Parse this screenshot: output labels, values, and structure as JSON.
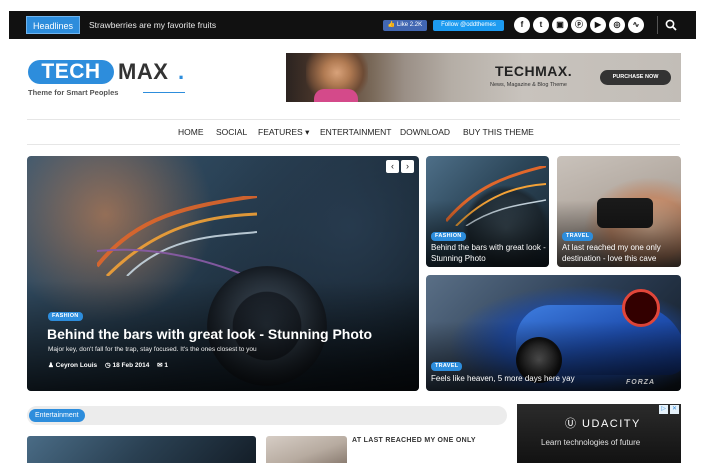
{
  "topbar": {
    "headlines_label": "Headlines",
    "ticker_text": "Strawberries are my favorite fruits",
    "fb_like": "👍 Like 2.2K",
    "tw_follow": "Follow @oddthemes",
    "social_icons": [
      "facebook-icon",
      "twitter-icon",
      "instagram-icon",
      "pinterest-icon",
      "youtube-icon",
      "dribbble-icon",
      "rss-icon"
    ],
    "social_glyphs": [
      "f",
      "t",
      "▣",
      "ⓟ",
      "▶",
      "◎",
      "∿"
    ],
    "search_icon": "search-icon"
  },
  "logo": {
    "part1": "TECH",
    "part2": "MAX",
    "dot": ".",
    "tagline": "Theme for Smart Peoples"
  },
  "banner": {
    "title": "TECHMAX.",
    "subtitle": "News, Magazine & Blog Theme",
    "button": "PURCHASE NOW"
  },
  "nav": {
    "items": [
      "HOME",
      "SOCIAL",
      "FEATURES ▾",
      "ENTERTAINMENT",
      "DOWNLOAD",
      "BUY THIS THEME"
    ]
  },
  "hero": {
    "prev_glyph": "‹",
    "next_glyph": "›",
    "category": "FASHION",
    "title": "Behind the bars with great look - Stunning Photo",
    "excerpt": "Major key, don't fall for the trap, stay focused. It's the ones closest to you",
    "author": "♟ Ceyron Louis",
    "date": "◷ 18 Feb 2014",
    "comments": "✉ 1"
  },
  "cards": [
    {
      "category": "FASHION",
      "title": "Behind the bars with great look - Stunning Photo"
    },
    {
      "category": "TRAVEL",
      "title": "At last reached my one only destination - love this cave"
    },
    {
      "category": "TRAVEL",
      "title": "Feels like heaven, 5 more days here yay",
      "watermark": "FORZA"
    }
  ],
  "section": {
    "label": "Entertainment",
    "bottom_title": "AT LAST REACHED MY ONE ONLY"
  },
  "ad": {
    "close_glyph": "▷",
    "x_glyph": "✕",
    "logo": "Ⓤ UDACITY",
    "subtitle": "Learn technologies of future"
  },
  "colors": {
    "accent": "#2d8ddc",
    "topbar": "#111111"
  }
}
